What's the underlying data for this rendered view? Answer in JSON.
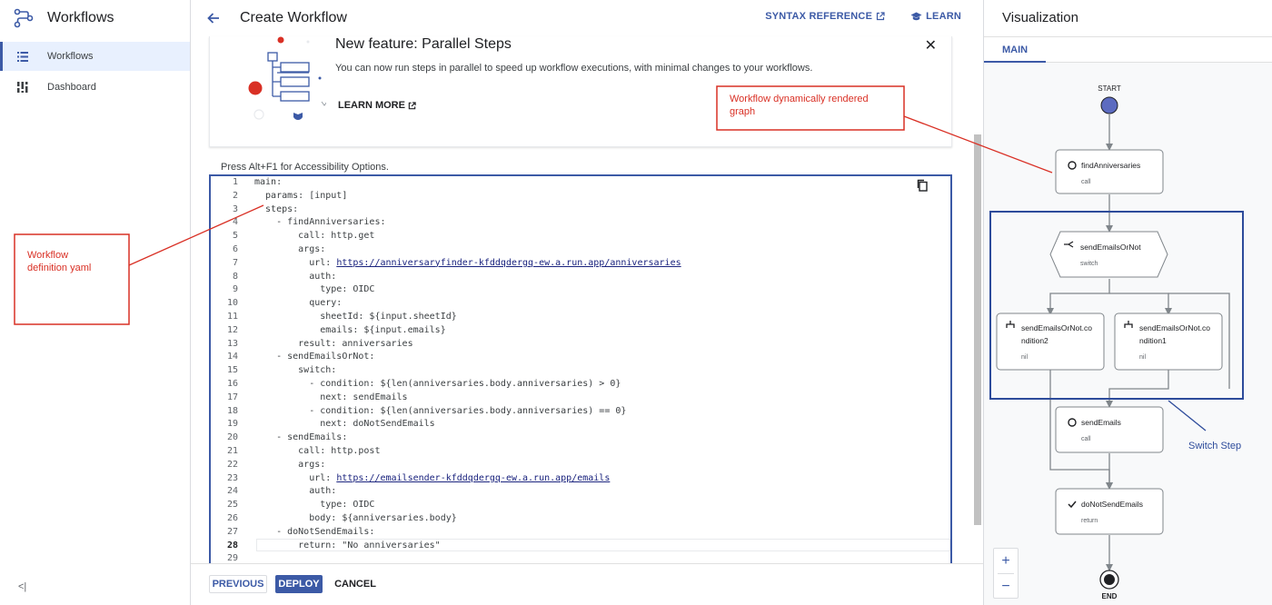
{
  "nav": {
    "title": "Workflows",
    "items": [
      {
        "label": "Workflows",
        "active": true,
        "icon": "list-icon"
      },
      {
        "label": "Dashboard",
        "active": false,
        "icon": "dashboard-icon"
      }
    ],
    "collapse_label": "<|"
  },
  "header": {
    "title": "Create Workflow",
    "syntax_reference": "SYNTAX REFERENCE",
    "learn": "LEARN"
  },
  "feature": {
    "title": "New feature: Parallel Steps",
    "description": "You can now run steps in parallel to speed up workflow executions, with minimal changes to your workflows.",
    "learn_more": "LEARN MORE",
    "close": "✕"
  },
  "editor": {
    "accessibility_note": "Press Alt+F1 for Accessibility Options.",
    "current_line": 28,
    "lines": [
      {
        "n": "1",
        "code": "main:"
      },
      {
        "n": "2",
        "code": "  params: [input]"
      },
      {
        "n": "3",
        "code": "  steps:"
      },
      {
        "n": "4",
        "code": "    - findAnniversaries:"
      },
      {
        "n": "5",
        "code": "        call: http.get"
      },
      {
        "n": "6",
        "code": "        args:"
      },
      {
        "n": "7",
        "code": "          url: ",
        "link": "https://anniversaryfinder-kfddqdergq-ew.a.run.app/anniversaries"
      },
      {
        "n": "8",
        "code": "          auth:"
      },
      {
        "n": "9",
        "code": "            type: OIDC"
      },
      {
        "n": "10",
        "code": "          query:"
      },
      {
        "n": "11",
        "code": "            sheetId: ${input.sheetId}"
      },
      {
        "n": "12",
        "code": "            emails: ${input.emails}"
      },
      {
        "n": "13",
        "code": "        result: anniversaries"
      },
      {
        "n": "14",
        "code": "    - sendEmailsOrNot:"
      },
      {
        "n": "15",
        "code": "        switch:"
      },
      {
        "n": "16",
        "code": "          - condition: ${len(anniversaries.body.anniversaries) > 0}"
      },
      {
        "n": "17",
        "code": "            next: sendEmails"
      },
      {
        "n": "18",
        "code": "          - condition: ${len(anniversaries.body.anniversaries) == 0}"
      },
      {
        "n": "19",
        "code": "            next: doNotSendEmails"
      },
      {
        "n": "20",
        "code": "    - sendEmails:"
      },
      {
        "n": "21",
        "code": "        call: http.post"
      },
      {
        "n": "22",
        "code": "        args:"
      },
      {
        "n": "23",
        "code": "          url: ",
        "link": "https://emailsender-kfddqdergq-ew.a.run.app/emails"
      },
      {
        "n": "24",
        "code": "          auth:"
      },
      {
        "n": "25",
        "code": "            type: OIDC"
      },
      {
        "n": "26",
        "code": "          body: ${anniversaries.body}"
      },
      {
        "n": "27",
        "code": "    - doNotSendEmails:"
      },
      {
        "n": "28",
        "code": "        return: \"No anniversaries\""
      },
      {
        "n": "29",
        "code": ""
      }
    ]
  },
  "footer": {
    "previous": "PREVIOUS",
    "deploy": "DEPLOY",
    "cancel": "CANCEL"
  },
  "viz": {
    "title": "Visualization",
    "tab": "MAIN",
    "start_label": "START",
    "end_label": "END",
    "zoom_in": "+",
    "zoom_out": "−",
    "nodes": {
      "find": {
        "name": "findAnniversaries",
        "sub": "call"
      },
      "switch": {
        "name": "sendEmailsOrNot",
        "sub": "switch"
      },
      "cond2": {
        "name1": "sendEmailsOrNot.co",
        "name2": "ndition2",
        "sub": "nil"
      },
      "cond1": {
        "name1": "sendEmailsOrNot.co",
        "name2": "ndition1",
        "sub": "nil"
      },
      "send": {
        "name": "sendEmails",
        "sub": "call"
      },
      "donot": {
        "name": "doNotSendEmails",
        "sub": "return"
      }
    }
  },
  "annotations": {
    "graph": {
      "line1": "Workflow dynamically rendered",
      "line2": "graph"
    },
    "yaml": {
      "line1": "Workflow",
      "line2": "definition yaml"
    },
    "switch": "Switch Step"
  },
  "colors": {
    "accent": "#3c5aa6",
    "annotation_red": "#d93025",
    "annotation_blue": "#2d4b9b"
  }
}
